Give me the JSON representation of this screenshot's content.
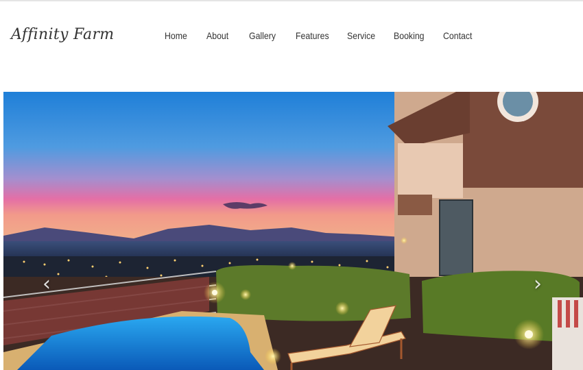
{
  "site": {
    "logo": "Affinity Farm"
  },
  "nav": {
    "items": [
      {
        "label": "Home"
      },
      {
        "label": "About"
      },
      {
        "label": "Gallery"
      },
      {
        "label": "Features"
      },
      {
        "label": "Service"
      },
      {
        "label": "Booking"
      },
      {
        "label": "Contact"
      }
    ]
  },
  "carousel": {
    "prev_icon": "chevron-left-icon",
    "next_icon": "chevron-right-icon",
    "prev_glyph": "‹",
    "next_glyph": "›",
    "image": "villa-pool-sunset"
  },
  "colors": {
    "text": "#333333",
    "sky_top": "#1e7fd6",
    "sky_glow": "#e06aa8"
  }
}
